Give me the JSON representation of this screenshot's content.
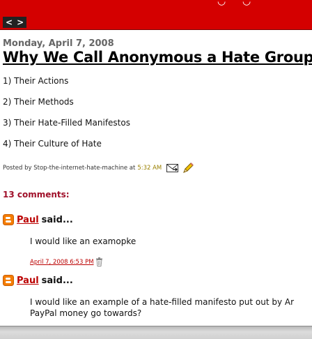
{
  "header": {
    "bg_color": "#d40000",
    "nav_prev": "<",
    "nav_next": ">"
  },
  "post": {
    "date": "Monday, April 7, 2008",
    "title": "Why We Call Anonymous a Hate Group",
    "items": [
      "1) Their Actions",
      "2) Their Methods",
      "3) Their Hate-Filled Manifestos",
      "4) Their Culture of Hate"
    ],
    "posted_by_prefix": "Posted by Stop-the-internet-hate-machine at",
    "time": "5:32 AM",
    "icons": [
      "email-post-icon",
      "edit-pencil-icon"
    ]
  },
  "comments": {
    "count_label": "13 comments:",
    "list": [
      {
        "author": "Paul",
        "said": "said...",
        "body": [
          "I would like an examopke"
        ],
        "timestamp": "April 7, 2008 6:53 PM",
        "icon": "blogger-icon"
      },
      {
        "author": "Paul",
        "said": "said...",
        "body": [
          "I would like an example of a hate-filled manifesto put out by Ar",
          "PayPal money go towards?"
        ],
        "icon": "blogger-icon"
      }
    ]
  },
  "colors": {
    "accent_red": "#bb0000",
    "comments_heading": "#a0102a",
    "time_gold": "#9a8000"
  }
}
